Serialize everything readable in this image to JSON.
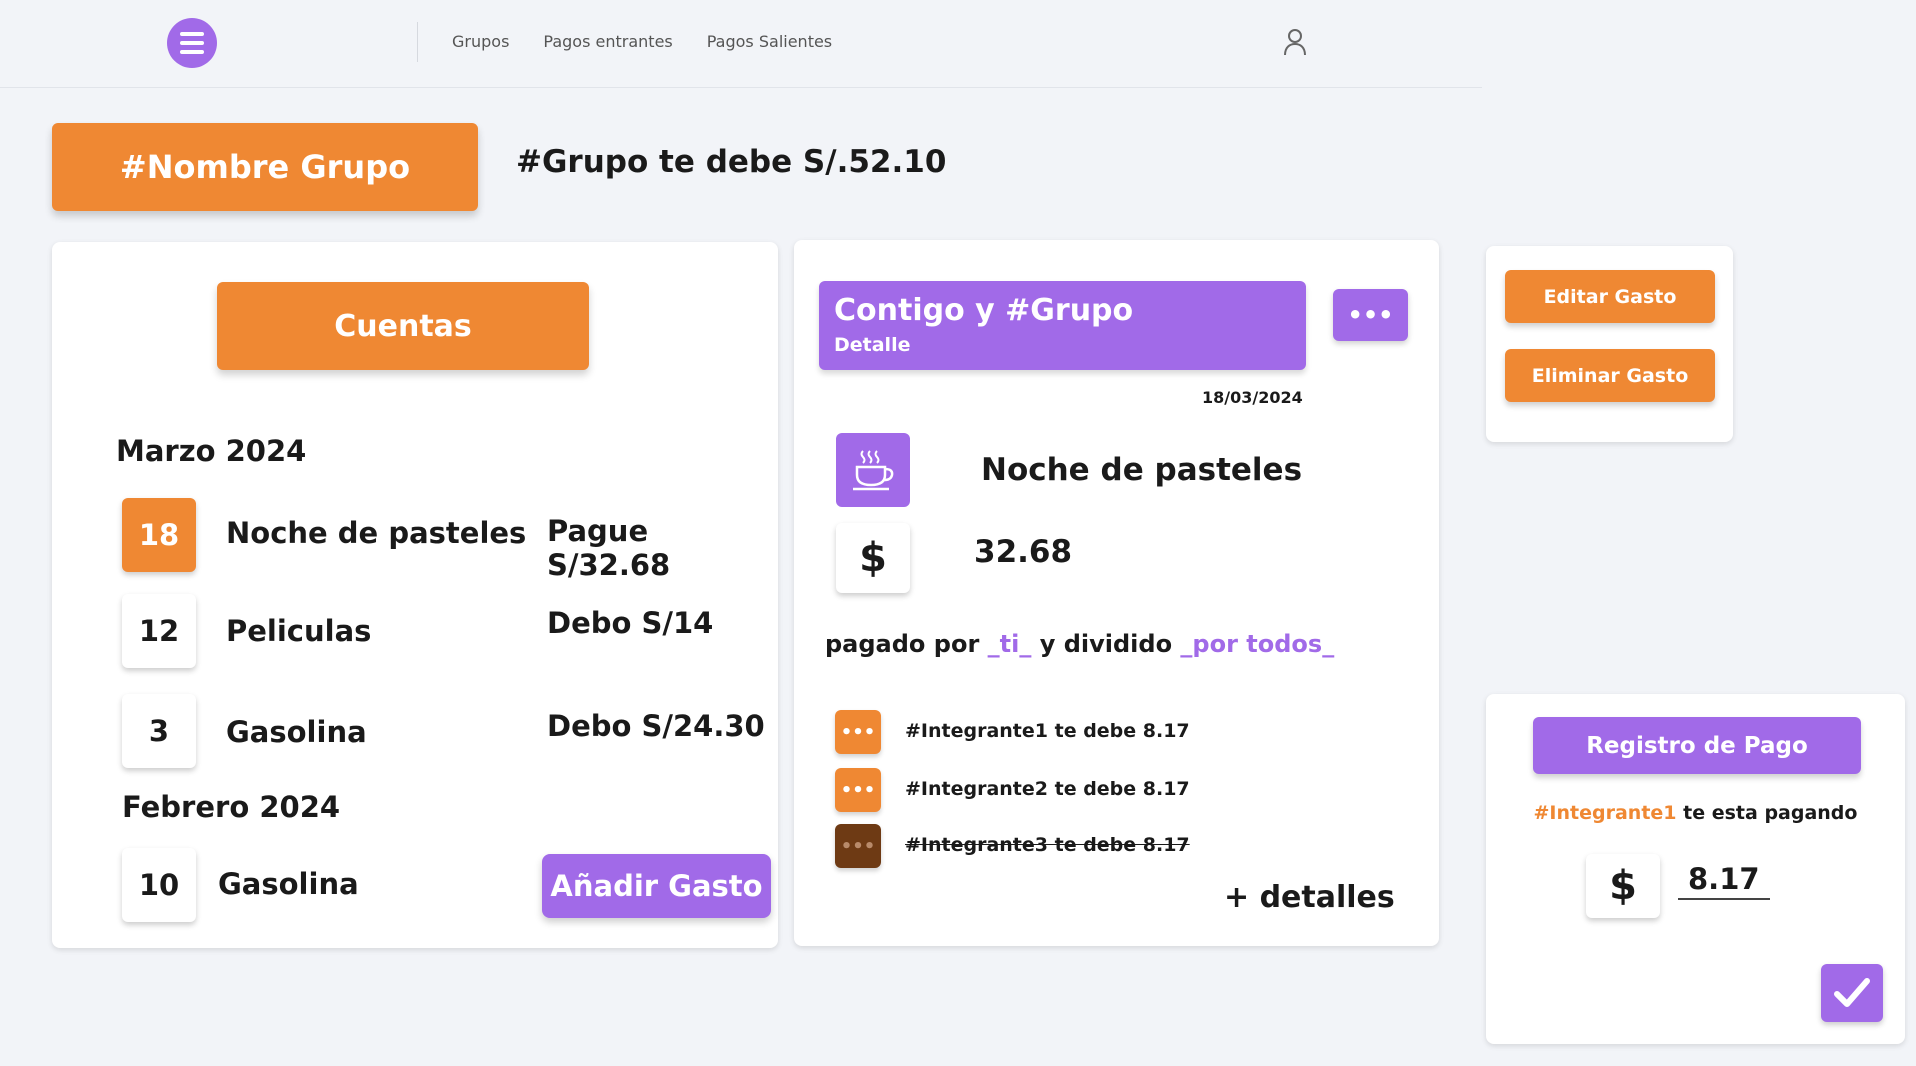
{
  "nav": {
    "items": [
      "Grupos",
      "Pagos entrantes",
      "Pagos Salientes"
    ]
  },
  "group": {
    "name": "#Nombre Grupo",
    "balance_text": "#Grupo te debe S/.52.10"
  },
  "accounts": {
    "title": "Cuentas",
    "months": [
      {
        "label": "Marzo 2024",
        "expenses": [
          {
            "day": "18",
            "name": "Noche de pasteles",
            "amount": "Pague S/32.68"
          },
          {
            "day": "12",
            "name": "Peliculas",
            "amount": "Debo S/14"
          },
          {
            "day": "3",
            "name": "Gasolina",
            "amount": "Debo S/24.30"
          }
        ]
      },
      {
        "label": "Febrero 2024",
        "expenses": [
          {
            "day": "10",
            "name": "Gasolina",
            "amount": ""
          }
        ]
      }
    ],
    "add_button": "Añadir Gasto"
  },
  "detail": {
    "title": "Contigo y #Grupo",
    "subtitle": "Detalle",
    "more_label": "•••",
    "date": "18/03/2024",
    "category_icon": "coffee-cup-icon",
    "name": "Noche de pasteles",
    "currency_symbol": "$",
    "amount": "32.68",
    "paid_by": {
      "prefix": "pagado por",
      "payer": "_ti_",
      "middle": "y dividido",
      "split": "_por todos_"
    },
    "members": [
      {
        "dots": "•••",
        "text": "#Integrante1 te debe 8.17",
        "settled": false
      },
      {
        "dots": "•••",
        "text": "#Integrante2 te debe 8.17",
        "settled": false
      },
      {
        "dots": "•••",
        "text": "#Integrante3 te debe 8.17",
        "settled": true
      }
    ],
    "more_details": "+ detalles"
  },
  "actions": {
    "edit": "Editar Gasto",
    "delete": "Eliminar Gasto"
  },
  "payment": {
    "title": "Registro de Pago",
    "payer": "#Integrante1",
    "payer_suffix": "te esta pagando",
    "currency_symbol": "$",
    "amount": "8.17"
  },
  "colors": {
    "orange": "#ef8833",
    "purple": "#a16ae8",
    "brown": "#6e3a14"
  }
}
